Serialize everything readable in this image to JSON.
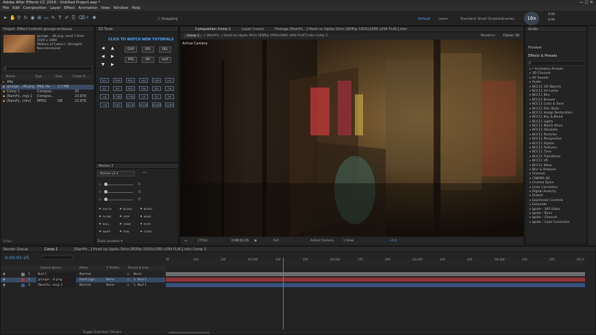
{
  "app": {
    "title": "Adobe After Effects CC 2018 - Untitled Project.aep *"
  },
  "menu": [
    "File",
    "Edit",
    "Composition",
    "Layer",
    "Effect",
    "Animation",
    "View",
    "Window",
    "Help"
  ],
  "toolbar": {
    "snapping": "Snapping",
    "workspaces": [
      "Default",
      "Learn",
      "Standard",
      "Small Screen",
      "Libraries"
    ],
    "zoom_badge": "16x",
    "meter_rows": [
      "0:00",
      "0:00"
    ]
  },
  "project": {
    "tab": "Project",
    "effect_tab": "Effect Controls grunge-embassy",
    "thumb_name": "grunge....46.png",
    "thumb_used": ", used 1 time",
    "thumb_dims": "1920 x 1080",
    "thumb_colors": "Millions of Colors+ (Straight)",
    "thumb_interp": "Non-Interlaced",
    "cols": [
      "Name",
      "Type",
      "Size",
      "Frame R..."
    ],
    "items": [
      {
        "name": "Абв",
        "type": "",
        "size": "",
        "fr": ""
      },
      {
        "name": "grunge-...46.png",
        "type": "PNG file",
        "size": "3.7 MB",
        "fr": ""
      },
      {
        "name": "Comp 1",
        "type": "Composi...",
        "size": "",
        "fr": "30"
      },
      {
        "name": "[NamFo...mp] 1",
        "type": "Composi...",
        "size": "",
        "fr": "23.976"
      },
      {
        "name": "[NamFo...mkv]",
        "type": "MPEG",
        "size": "GB",
        "fr": "23.976"
      }
    ],
    "footer": "8 bpc"
  },
  "ez": {
    "tab": "EZ Tools",
    "title": "CLICK TO WATCH NEW TUTORIALS",
    "row1": [
      "DUP",
      "SPL",
      "DEL"
    ],
    "row2": [
      "PRE",
      "INF",
      "outF"
    ],
    "grid": [
      "SOL",
      "ONA",
      "NUL",
      "ADJ",
      "CAM",
      "LIG",
      "EZ",
      "ED",
      "REG",
      "TRK",
      "TRL",
      "ON",
      "+N",
      "+TRK",
      "+TRE",
      "+P",
      "FX",
      "FM",
      "+M",
      "FIAT",
      "BLUR",
      "GLOW",
      "SHARP",
      "CURV"
    ]
  },
  "motion": {
    "tab": "Motion 2",
    "preset": "Motion v2",
    "vals": [
      "0",
      "0",
      "0"
    ],
    "actions": [
      "EXCITE",
      "BLEND",
      "BURST",
      "CLONE",
      "JUMP",
      "NAME",
      "NULL",
      "ORBIT",
      "ROPE",
      "WARP",
      "SPIN",
      "STARE"
    ],
    "footer": "Track Location"
  },
  "comp": {
    "tabs": [
      "Composition Comp 1",
      "Layer (none)",
      "Footage [NamFo...] Hood na Ugoku Shiro [BDRip 1920x1080 x264 FLAC].mkv"
    ],
    "subtabs": [
      "Comp 1",
      "[NamFo...] Hood na Ugoku Shiro [BDRip 1920x1080 x264 FLAC].mkv Comp 1"
    ],
    "renderer": "Renderer:",
    "renderer_val": "Classic 3D",
    "camera": "Active Camera",
    "footer": {
      "zoom": "(75%)",
      "time": "0:00:01:25",
      "res": "Full",
      "cam": "Active Camera",
      "view": "1 View",
      "exp": "+0.0"
    }
  },
  "effects": {
    "tabs": [
      "Audio",
      "Preview",
      "Effects & Presets"
    ],
    "items": [
      "* Animation Presets",
      "3D Channel",
      "AE Sweets",
      "Audio",
      "BCC11 3D Objects",
      "BCC11 Art Looks",
      "BCC11 Blur",
      "BCC11 Browse",
      "BCC11 Color & Tone",
      "BCC11 Film Style",
      "BCC11 Image Restoration",
      "BCC11 Key & Blend",
      "BCC11 Lights",
      "BCC11 Match Move",
      "BCC11 Obsolete",
      "BCC11 Particles",
      "BCC11 Perspective",
      "BCC11 Stylize",
      "BCC11 Textures",
      "BCC11 Time",
      "BCC11 Transitions",
      "BCC11 VR",
      "BCC11 Warp",
      "Blur & Sharpen",
      "Channel",
      "CINEMA 4D",
      "Cinema Spice",
      "Color Correction",
      "Digital Anarchy",
      "Distort",
      "Expression Controls",
      "Generate",
      "Ignite - 360 Video",
      "Ignite - Blurs",
      "Ignite - Channel",
      "Ignite - Color Correction"
    ]
  },
  "timeline": {
    "tabs": [
      "Render Queue",
      "Comp 1",
      "[NamFo...] Hood na Ugoku Shiro [BDRip 1920x1080 x264 FLAC].mkv Comp 1"
    ],
    "time": "0:00:01:25",
    "cols": [
      "Source Name",
      "Mode",
      "T TrkMat",
      "Parent & Link"
    ],
    "layers": [
      {
        "num": "1",
        "name": "Null 1",
        "mode": "Normal",
        "trk": "",
        "parent": "None"
      },
      {
        "num": "2",
        "name": "grunge-...6.png",
        "mode": "Hard Ligh...",
        "trk": "None",
        "parent": "1. Null 1"
      },
      {
        "num": "3",
        "name": "[NamFo...omp 1",
        "mode": "Normal",
        "trk": "None",
        "parent": "1. Null 1"
      }
    ],
    "ruler": [
      "0f",
      "10f",
      "20f",
      "01:00f",
      "10f",
      "20f",
      "02:00f",
      "10f",
      "20f",
      "03:00f",
      "10f",
      "20f",
      "04:00f",
      "10f",
      "20f",
      "05:0"
    ],
    "playhead_frac": 0.28,
    "footer": "Toggle Switches / Modes"
  },
  "colors": {
    "accent": "#2d8ceb",
    "layer_red": "#a4353b",
    "layer_gray": "#7a7a7a",
    "layer_blue": "#3a5a8a"
  }
}
